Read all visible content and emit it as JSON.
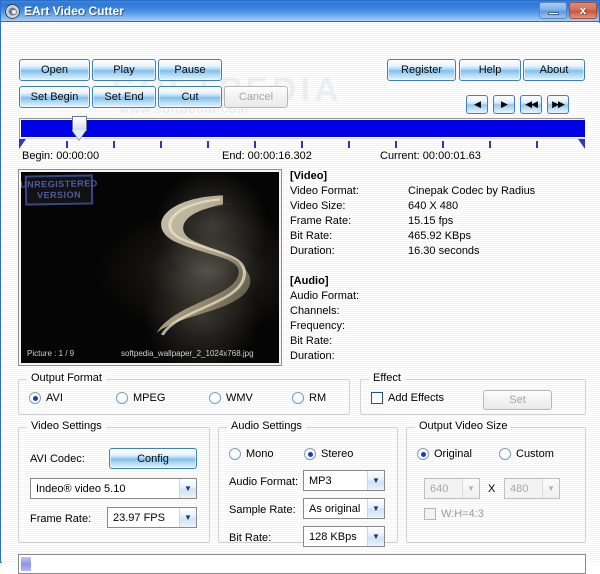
{
  "window": {
    "title": "EArt Video Cutter",
    "icon": "disc-icon",
    "minimize_label": "_",
    "close_label": "x"
  },
  "toolbar": {
    "open": "Open",
    "play": "Play",
    "pause": "Pause",
    "set_begin": "Set Begin",
    "set_end": "Set End",
    "cut": "Cut",
    "cancel": "Cancel",
    "register": "Register",
    "help": "Help",
    "about": "About"
  },
  "navigation": {
    "prev": "◀",
    "next": "▶",
    "rewind": "◀◀",
    "forward": "▶▶"
  },
  "timeline": {
    "begin": "Begin: 00:00:00",
    "end": "End: 00:00:16.302",
    "current": "Current: 00:00:01.63",
    "position_percent": 11,
    "fill_color": "#0000e8",
    "tick_count": 11
  },
  "preview": {
    "stamp_line1": "UNREGISTERED",
    "stamp_line2": "VERSION",
    "picture_index": "Picture : 1 / 9",
    "file_name": "softpedia_wallpaper_2_1024x768.jpg"
  },
  "media_info": {
    "video_header": "[Video]",
    "video_rows": [
      {
        "label": "Video Format:",
        "value": "Cinepak Codec by Radius"
      },
      {
        "label": "Video Size:",
        "value": "640 X 480"
      },
      {
        "label": "Frame Rate:",
        "value": "15.15 fps"
      },
      {
        "label": "Bit Rate:",
        "value": "465.92 KBps"
      },
      {
        "label": "Duration:",
        "value": "16.30 seconds"
      }
    ],
    "audio_header": "[Audio]",
    "audio_rows": [
      {
        "label": "Audio Format:",
        "value": ""
      },
      {
        "label": "Channels:",
        "value": ""
      },
      {
        "label": "Frequency:",
        "value": ""
      },
      {
        "label": "Bit Rate:",
        "value": ""
      },
      {
        "label": "Duration:",
        "value": ""
      }
    ]
  },
  "output_format": {
    "legend": "Output Format",
    "options": [
      {
        "label": "AVI",
        "selected": true
      },
      {
        "label": "MPEG",
        "selected": false
      },
      {
        "label": "WMV",
        "selected": false
      },
      {
        "label": "RM",
        "selected": false
      }
    ]
  },
  "effect": {
    "legend": "Effect",
    "add_effects_label": "Add Effects",
    "add_effects_checked": false,
    "set_label": "Set",
    "set_enabled": false
  },
  "video_settings": {
    "legend": "Video Settings",
    "codec_label": "AVI Codec:",
    "config_label": "Config",
    "codec_value": "Indeo® video 5.10",
    "frame_rate_label": "Frame Rate:",
    "frame_rate_value": "23.97 FPS"
  },
  "audio_settings": {
    "legend": "Audio Settings",
    "mono_label": "Mono",
    "stereo_label": "Stereo",
    "channel_selected": "Stereo",
    "format_label": "Audio Format:",
    "format_value": "MP3",
    "sample_rate_label": "Sample Rate:",
    "sample_rate_value": "As original",
    "bit_rate_label": "Bit Rate:",
    "bit_rate_value": "128 KBps"
  },
  "output_size": {
    "legend": "Output Video Size",
    "original_label": "Original",
    "custom_label": "Custom",
    "selected": "Original",
    "width_value": "640",
    "separator": "X",
    "height_value": "480",
    "ratio_label": "W:H=4:3",
    "ratio_checked": false,
    "enabled": false
  },
  "status_bar": {
    "text": ""
  },
  "watermark": {
    "line1": "SOFTPEDIA",
    "line2": "www.softpedia.com"
  },
  "colors": {
    "title_bar": "#2f77d6",
    "button_accent": "#7ec0ec",
    "timeline_fill": "#0000e8",
    "radio_dot": "#1a3fa8"
  }
}
